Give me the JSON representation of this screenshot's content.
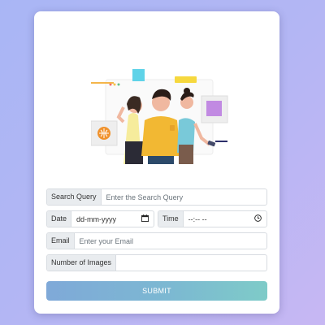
{
  "form": {
    "search_label": "Search Query",
    "search_placeholder": "Enter the Search Query",
    "date_label": "Date",
    "date_placeholder": "dd-mm-yyyy",
    "time_label": "Time",
    "time_placeholder": "--:-- --",
    "email_label": "Email",
    "email_placeholder": "Enter your Email",
    "images_label": "Number of Images",
    "images_value": "",
    "submit_label": "SUBMIT"
  },
  "icons": {
    "date": "calendar-icon",
    "time": "clock-icon"
  },
  "colors": {
    "background_start": "#a9b6f5",
    "background_end": "#c7b7f3",
    "button_start": "#7fa9d8",
    "button_end": "#7ecbc8",
    "addon_bg": "#e9ecef"
  }
}
